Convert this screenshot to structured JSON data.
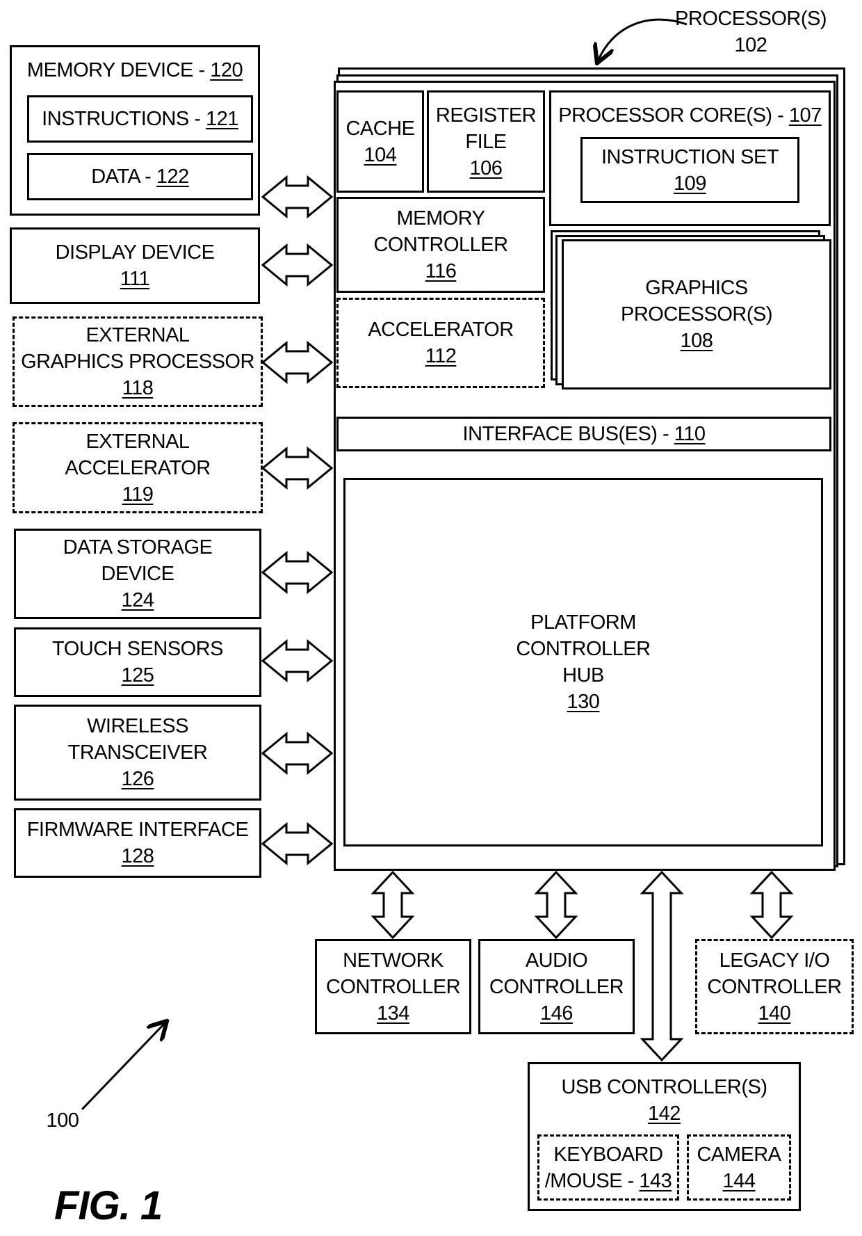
{
  "figure": {
    "title": "FIG. 1",
    "system_ref": "100",
    "processor_label": "PROCESSOR(S)",
    "processor_ref": "102"
  },
  "left_components": [
    {
      "id": "memory-device",
      "label": "MEMORY DEVICE - ",
      "ref": "120",
      "style": "solid",
      "children": [
        {
          "label": "INSTRUCTIONS - ",
          "ref": "121"
        },
        {
          "label": "DATA - ",
          "ref": "122"
        }
      ]
    },
    {
      "id": "display-device",
      "lines": [
        "DISPLAY DEVICE"
      ],
      "ref": "111",
      "style": "solid"
    },
    {
      "id": "external-graphics-processor",
      "lines": [
        "EXTERNAL",
        "GRAPHICS PROCESSOR"
      ],
      "ref": "118",
      "style": "dashed"
    },
    {
      "id": "external-accelerator",
      "lines": [
        "EXTERNAL",
        "ACCELERATOR"
      ],
      "ref": "119",
      "style": "dashed"
    },
    {
      "id": "data-storage-device",
      "lines": [
        "DATA STORAGE",
        "DEVICE"
      ],
      "ref": "124",
      "style": "solid"
    },
    {
      "id": "touch-sensors",
      "lines": [
        "TOUCH SENSORS"
      ],
      "ref": "125",
      "style": "solid"
    },
    {
      "id": "wireless-transceiver",
      "lines": [
        "WIRELESS",
        "TRANSCEIVER"
      ],
      "ref": "126",
      "style": "solid"
    },
    {
      "id": "firmware-interface",
      "lines": [
        "FIRMWARE INTERFACE"
      ],
      "ref": "128",
      "style": "solid"
    }
  ],
  "processor_components": {
    "cache": {
      "lines": [
        "CACHE"
      ],
      "ref": "104"
    },
    "register_file": {
      "lines": [
        "REGISTER",
        "FILE"
      ],
      "ref": "106"
    },
    "processor_cores": {
      "label": "PROCESSOR CORE(S) - ",
      "ref": "107"
    },
    "instruction_set": {
      "lines": [
        "INSTRUCTION SET"
      ],
      "ref": "109"
    },
    "memory_controller": {
      "lines": [
        "MEMORY",
        "CONTROLLER"
      ],
      "ref": "116"
    },
    "accelerator": {
      "lines": [
        "ACCELERATOR"
      ],
      "ref": "112"
    },
    "graphics_processors": {
      "lines": [
        "GRAPHICS",
        "PROCESSOR(S)"
      ],
      "ref": "108"
    },
    "interface_bus": {
      "label": "INTERFACE BUS(ES) - ",
      "ref": "110"
    },
    "platform_controller_hub": {
      "lines": [
        "PLATFORM",
        "CONTROLLER",
        "HUB"
      ],
      "ref": "130"
    }
  },
  "bottom_components": {
    "network_controller": {
      "lines": [
        "NETWORK",
        "CONTROLLER"
      ],
      "ref": "134"
    },
    "audio_controller": {
      "lines": [
        "AUDIO",
        "CONTROLLER"
      ],
      "ref": "146"
    },
    "legacy_io_controller": {
      "lines": [
        "LEGACY I/O",
        "CONTROLLER"
      ],
      "ref": "140"
    },
    "usb_controllers": {
      "lines": [
        "USB CONTROLLER(S)"
      ],
      "ref": "142"
    },
    "keyboard_mouse": {
      "lines": [
        "KEYBOARD",
        "/MOUSE - "
      ],
      "ref": "143"
    },
    "camera": {
      "lines": [
        "CAMERA"
      ],
      "ref": "144"
    }
  }
}
